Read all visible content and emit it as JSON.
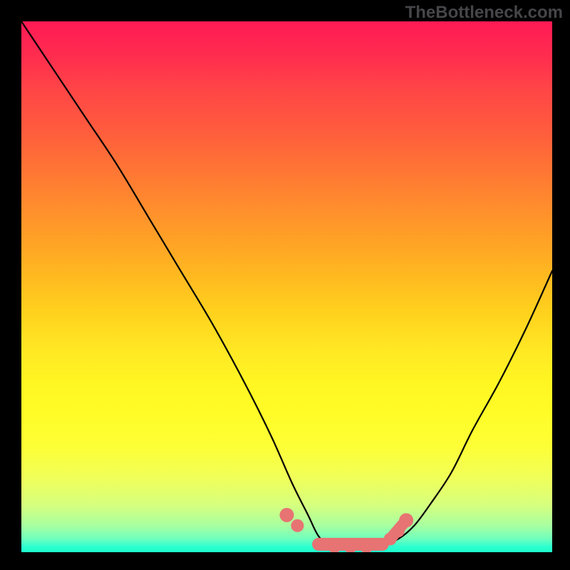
{
  "watermark": "TheBottleneck.com",
  "colors": {
    "background": "#000000",
    "stroke_black": "#000000",
    "highlight_salmon": "#e77373"
  },
  "chart_data": {
    "type": "line",
    "title": "",
    "xlabel": "",
    "ylabel": "",
    "xlim": [
      0,
      100
    ],
    "ylim": [
      0,
      100
    ],
    "annotations": [
      "TheBottleneck.com"
    ],
    "series": [
      {
        "name": "bottleneck-curve",
        "x": [
          0,
          6,
          12,
          18,
          24,
          30,
          36,
          42,
          47,
          51,
          54,
          56,
          58,
          61,
          65,
          68,
          71,
          74,
          77,
          81,
          85,
          90,
          95,
          100
        ],
        "y": [
          100,
          91,
          82,
          73,
          63,
          53,
          43,
          32,
          22,
          13,
          7,
          3,
          1.5,
          1,
          1,
          1.5,
          2.5,
          5,
          9,
          15,
          23,
          32,
          42,
          53
        ]
      },
      {
        "name": "highlight-dots",
        "x": [
          50,
          52,
          56,
          59,
          62,
          65,
          68,
          69.5,
          71,
          72.5
        ],
        "y": [
          7,
          5,
          1.5,
          1,
          1,
          1,
          1.5,
          2.5,
          4,
          6
        ]
      }
    ]
  }
}
